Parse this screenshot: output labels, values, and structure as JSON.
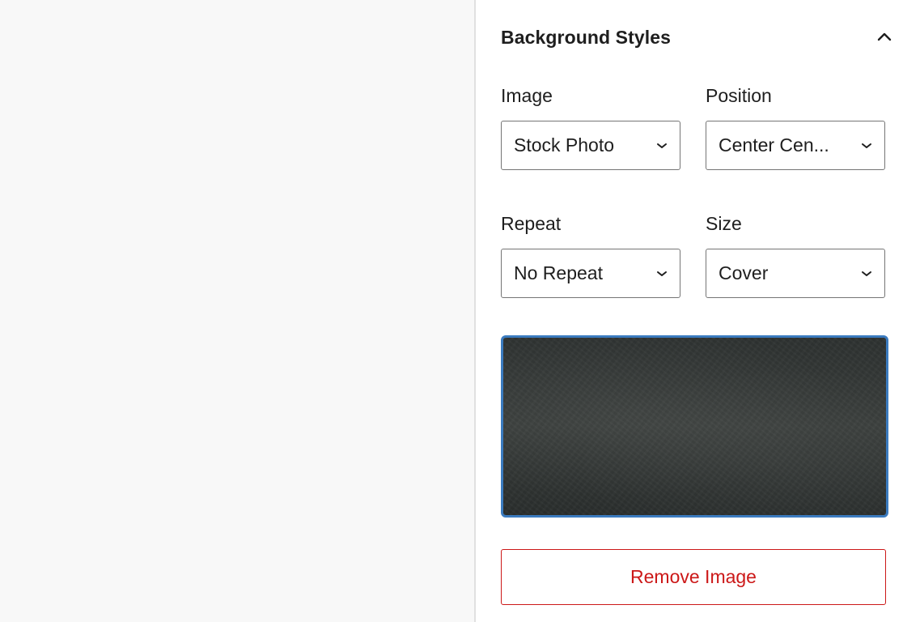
{
  "panel": {
    "title": "Background Styles",
    "expanded": true
  },
  "fields": {
    "image": {
      "label": "Image",
      "value": "Stock Photo"
    },
    "position": {
      "label": "Position",
      "value": "Center Cen..."
    },
    "repeat": {
      "label": "Repeat",
      "value": "No Repeat"
    },
    "size": {
      "label": "Size",
      "value": "Cover"
    }
  },
  "preview": {
    "icon": "dark-texture-image",
    "border_color": "#3b7bbf"
  },
  "actions": {
    "remove_label": "Remove Image"
  },
  "colors": {
    "danger": "#cc1818",
    "canvas_bg": "#f8f8f8",
    "sidebar_bg": "#ffffff"
  }
}
